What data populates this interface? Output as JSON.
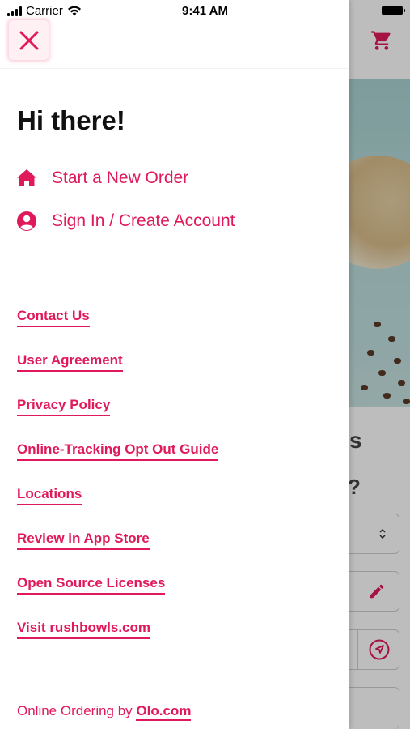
{
  "status_bar": {
    "carrier": "Carrier",
    "time": "9:41 AM"
  },
  "drawer": {
    "greeting": "Hi there!",
    "primary_items": [
      {
        "label": "Start a New Order",
        "icon": "home-icon"
      },
      {
        "label": "Sign In / Create Account",
        "icon": "user-circle-icon"
      }
    ],
    "links": [
      "Contact Us",
      "User Agreement",
      "Privacy Policy",
      "Online-Tracking Opt Out Guide",
      "Locations",
      "Review in App Store",
      "Open Source Licenses",
      "Visit rushbowls.com"
    ],
    "footer": {
      "prefix": "Online Ordering by",
      "link": "Olo.com"
    }
  },
  "background": {
    "heading_partial": "s",
    "question_partial": "?"
  },
  "colors": {
    "accent": "#e01a5a",
    "text": "#111111",
    "scrim": "rgba(0,0,0,0.26)"
  }
}
